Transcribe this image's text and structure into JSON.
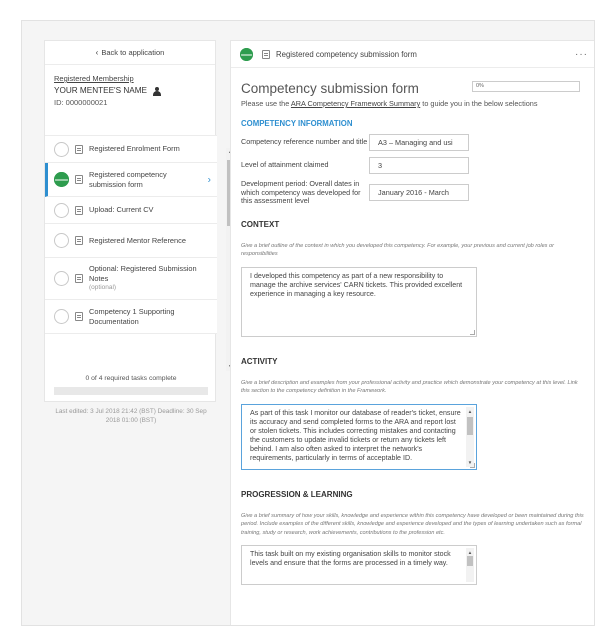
{
  "sidebar": {
    "back_label": "Back to application",
    "member_link": "Registered Membership",
    "mentee_name": "YOUR MENTEE'S NAME",
    "mentee_id": "ID: 0000000021",
    "tasks": [
      {
        "label": "Registered Enrolment Form",
        "sub": ""
      },
      {
        "label": "Registered competency submission form",
        "sub": ""
      },
      {
        "label": "Upload: Current CV",
        "sub": ""
      },
      {
        "label": "Registered Mentor Reference",
        "sub": ""
      },
      {
        "label": "Optional: Registered Submission Notes",
        "sub": "(optional)"
      },
      {
        "label": "Competency 1 Supporting Documentation",
        "sub": ""
      }
    ],
    "tasks_complete": "0 of 4 required tasks complete",
    "progress_fraction": 0,
    "last_edited": "Last edited: 3 Jul 2018 21:42 (BST) Deadline: 30 Sep 2018 01:00 (BST)"
  },
  "main": {
    "header_title": "Registered competency submission form",
    "more_label": "···",
    "form_title": "Competency submission form",
    "percent": "0%",
    "guide_prefix": "Please use the ",
    "guide_link": "ARA Competency Framework Summary",
    "guide_suffix": " to guide you in the below selections",
    "competency_section": "COMPETENCY INFORMATION",
    "fields": [
      {
        "label": "Competency reference number and title",
        "value": "A3 – Managing and usi"
      },
      {
        "label": "Level of attainment claimed",
        "value": "3"
      },
      {
        "label": "Development period: Overall dates in which competency was developed for this assessment level",
        "value": "January 2016 -  March"
      }
    ],
    "context": {
      "title": "CONTEXT",
      "hint": "Give a brief outline of the context in which you developed this competency. For example, your previous and current job roles or responsibilities",
      "text": "I developed this competency as part of a new responsibility to manage the archive services' CARN tickets. This provided excellent experience in managing a key resource."
    },
    "activity": {
      "title": "ACTIVITY",
      "hint": "Give a brief description and examples from your professional activity and practice which demonstrate your competency at this level. Link this section to the competency definition in the Framework.",
      "text": "As part of this task I monitor our database of reader's ticket, ensure its accuracy and send completed forms to the ARA and report lost or stolen tickets. This includes correcting mistakes and contacting the customers to update invalid tickets or return any tickets left behind. I am also often asked to interpret the network's requirements, particularly in terms of acceptable ID."
    },
    "progression": {
      "title": "PROGRESSION & LEARNING",
      "hint": "Give a brief summary of how your skills, knowledge and experience within this competency have developed or been maintained during this period. Include examples of the different skills, knowledge and experience developed and the types of learning undertaken such as formal training, study or research, work achievements, contributions to the profession etc.",
      "text": "This task built on my existing organisation skills to monitor stock levels and ensure that the forms are processed in a timely way."
    }
  }
}
